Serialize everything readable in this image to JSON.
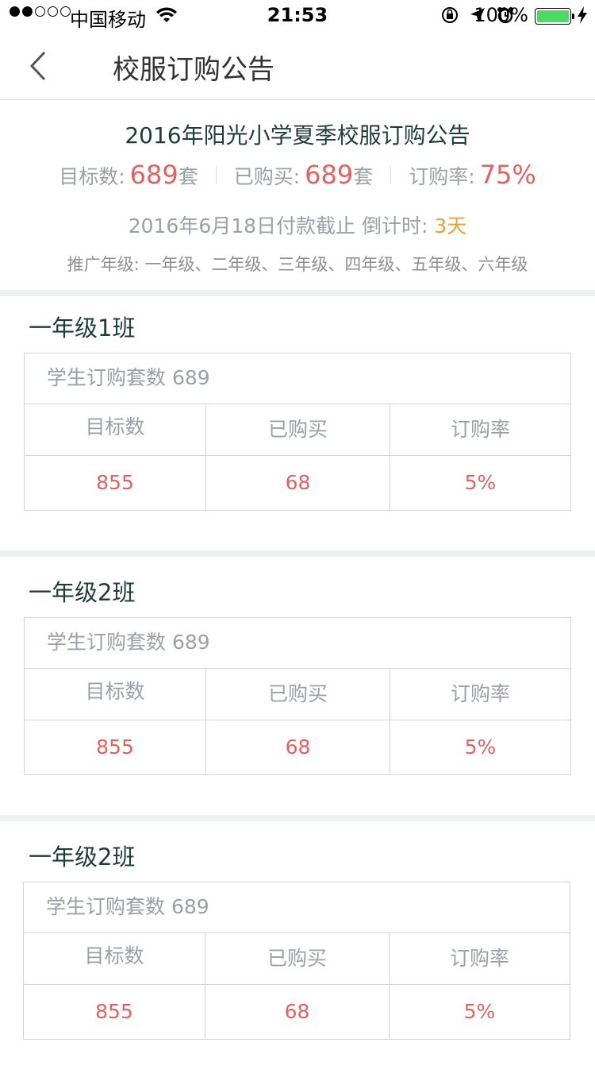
{
  "status_bar": {
    "carrier": "中国移动",
    "time": "21:53",
    "battery": "100%",
    "icons": [
      "signal-dots-icon",
      "wifi-icon",
      "orientation-lock-icon",
      "location-arrow-icon",
      "alarm-icon",
      "battery-icon",
      "charging-bolt-icon"
    ]
  },
  "nav": {
    "back_icon": "chevron-left-icon",
    "title": "校服订购公告"
  },
  "summary": {
    "title": "2016年阳光小学夏季校服订购公告",
    "target_label": "目标数:",
    "target_value": "689",
    "target_unit": "套",
    "bought_label": "已购买:",
    "bought_value": "689",
    "bought_unit": "套",
    "rate_label": "订购率:",
    "rate_value": "75%",
    "deadline_text": "2016年6月18日付款截止 倒计时:",
    "deadline_days": "3天",
    "grades_label": "推广年级:",
    "grades": "一年级、二年级、三年级、四年级、五年级、六年级"
  },
  "colors": {
    "accent_red": "#e56160",
    "accent_orange": "#e8a13a",
    "title_green": "#1f3d35",
    "muted_gray": "#9aa0ab"
  },
  "classes": [
    {
      "name": "一年级1班",
      "header": "学生订购套数 689",
      "columns": [
        "目标数",
        "已购买",
        "订购率"
      ],
      "values": [
        "855",
        "68",
        "5%"
      ]
    },
    {
      "name": "一年级2班",
      "header": "学生订购套数 689",
      "columns": [
        "目标数",
        "已购买",
        "订购率"
      ],
      "values": [
        "855",
        "68",
        "5%"
      ]
    },
    {
      "name": "一年级2班",
      "header": "学生订购套数 689",
      "columns": [
        "目标数",
        "已购买",
        "订购率"
      ],
      "values": [
        "855",
        "68",
        "5%"
      ]
    }
  ]
}
